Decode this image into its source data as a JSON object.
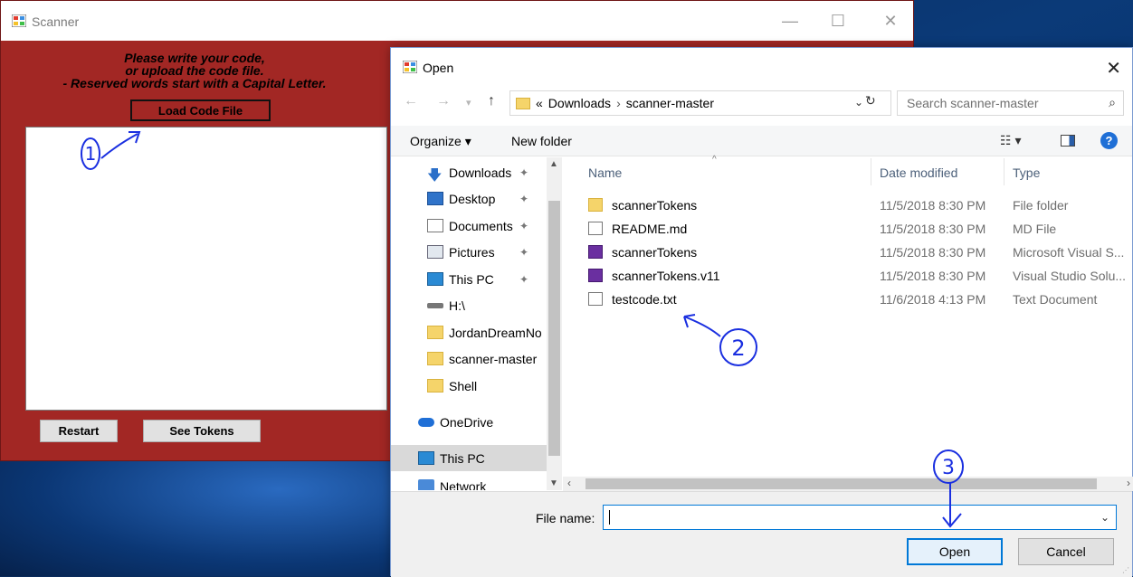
{
  "scanner": {
    "title": "Scanner",
    "controls": {
      "minimize": "—",
      "maximize": "☐",
      "close": "✕"
    },
    "instructions": [
      "Please write your code,",
      "or upload the code file.",
      "- Reserved words start with a Capital Letter."
    ],
    "load_button": "Load Code File",
    "code_text": "",
    "restart_button": "Restart",
    "tokens_button": "See Tokens"
  },
  "dialog": {
    "title": "Open",
    "close": "✕",
    "address": {
      "prefix": "«",
      "crumbs": [
        "Downloads",
        "scanner-master"
      ]
    },
    "search_placeholder": "Search scanner-master",
    "toolbar": {
      "organize": "Organize ▾",
      "new_folder": "New folder",
      "help": "?"
    },
    "nav_items": [
      {
        "label": "Downloads",
        "pinned": true
      },
      {
        "label": "Desktop",
        "pinned": true
      },
      {
        "label": "Documents",
        "pinned": true
      },
      {
        "label": "Pictures",
        "pinned": true
      },
      {
        "label": "This PC",
        "pinned": true
      },
      {
        "label": "H:\\"
      },
      {
        "label": "JordanDreamNo"
      },
      {
        "label": "scanner-master"
      },
      {
        "label": "Shell"
      },
      {
        "label": "OneDrive"
      },
      {
        "label": "This PC",
        "selected": true
      },
      {
        "label": "Network"
      }
    ],
    "columns": {
      "name": "Name",
      "date": "Date modified",
      "type": "Type"
    },
    "files": [
      {
        "name": "scannerTokens",
        "date": "11/5/2018 8:30 PM",
        "type": "File folder",
        "icon": "folder-icon"
      },
      {
        "name": "README.md",
        "date": "11/5/2018 8:30 PM",
        "type": "MD File",
        "icon": "document-icon"
      },
      {
        "name": "scannerTokens",
        "date": "11/5/2018 8:30 PM",
        "type": "Microsoft Visual S...",
        "icon": "visual-studio-icon"
      },
      {
        "name": "scannerTokens.v11",
        "date": "11/5/2018 8:30 PM",
        "type": "Visual Studio Solu...",
        "icon": "visual-studio-icon"
      },
      {
        "name": "testcode.txt",
        "date": "11/6/2018 4:13 PM",
        "type": "Text Document",
        "icon": "text-file-icon"
      }
    ],
    "file_name_label": "File name:",
    "file_name_value": "",
    "open_button": "Open",
    "cancel_button": "Cancel"
  },
  "annotations": {
    "step1": "1",
    "step2": "2",
    "step3": "3"
  },
  "colors": {
    "app_bg": "#a22724",
    "accent": "#0078d7",
    "annotation": "#1a2fe0"
  }
}
